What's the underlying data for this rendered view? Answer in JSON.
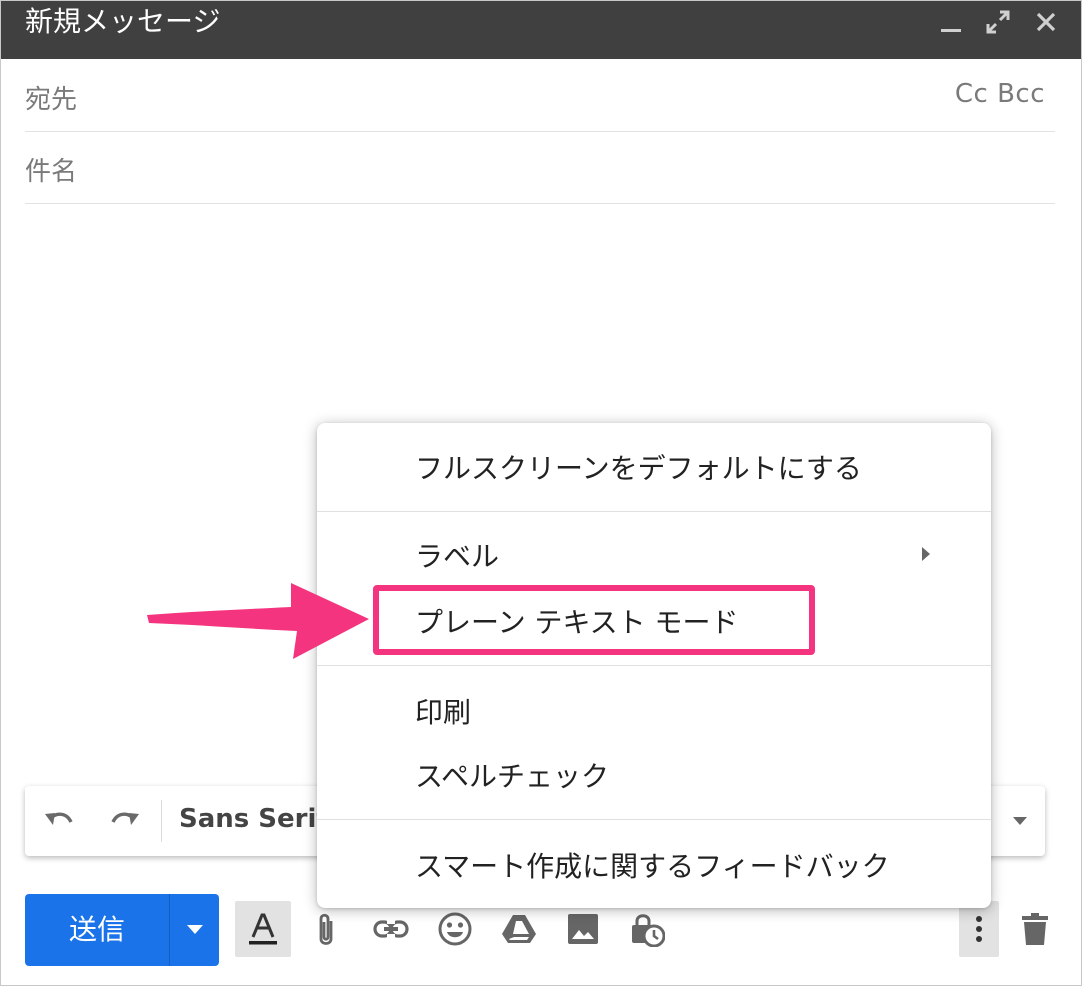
{
  "window": {
    "title": "新規メッセージ",
    "controls": [
      "minimize-icon",
      "fullscreen-icon",
      "close-icon"
    ]
  },
  "fields": {
    "to_label": "宛先",
    "cc_bcc": "Cc Bcc",
    "subject_label": "件名"
  },
  "format_toolbar": {
    "font_family": "Sans Serif",
    "icons": [
      "undo-icon",
      "redo-icon",
      "dropdown-arrow-icon"
    ]
  },
  "bottom_bar": {
    "send_label": "送信",
    "icons": [
      "text-format-icon",
      "attachment-icon",
      "link-icon",
      "emoji-icon",
      "drive-icon",
      "photo-icon",
      "confidential-mode-icon",
      "more-options-icon",
      "trash-icon"
    ]
  },
  "menu": {
    "items": [
      {
        "label": "フルスクリーンをデフォルトにする"
      },
      {
        "label": "ラベル",
        "has_submenu": true
      },
      {
        "label": "プレーン テキスト モード",
        "highlighted": true
      },
      {
        "label": "印刷"
      },
      {
        "label": "スペルチェック"
      },
      {
        "label": "スマート作成に関するフィードバック"
      }
    ]
  },
  "colors": {
    "titlebar": "#404040",
    "send_button": "#1a73e8",
    "highlight": "#f5347f"
  }
}
